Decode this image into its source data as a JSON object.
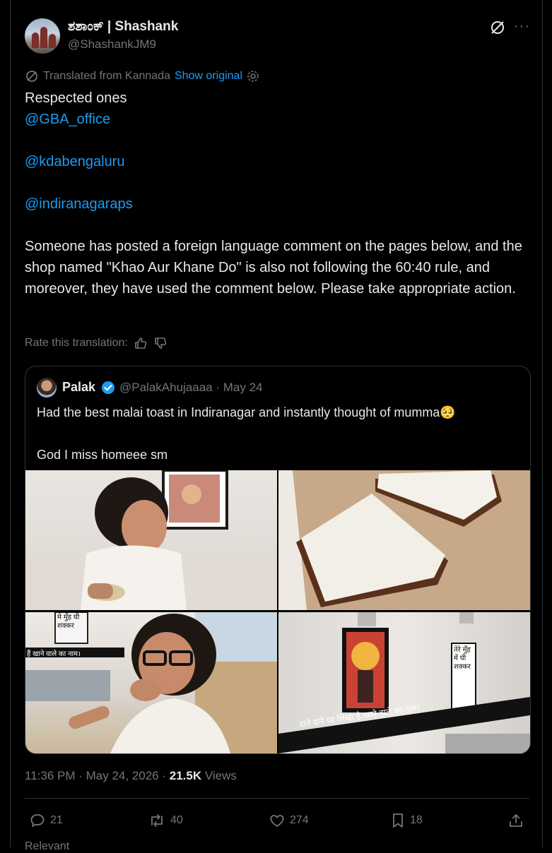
{
  "tweet": {
    "author_name": "ಶಶಾಂಕ್ | Shashank",
    "author_handle": "@ShashankJM9",
    "translated_label": "Translated from Kannada",
    "show_original": "Show original",
    "paragraphs": [
      {
        "text": "Respected ones",
        "type": "text"
      },
      {
        "text": "@GBA_office",
        "type": "mention"
      },
      {
        "text": "",
        "type": "blank"
      },
      {
        "text": "@kdabengaluru",
        "type": "mention"
      },
      {
        "text": "",
        "type": "blank"
      },
      {
        "text": "@indiranagaraps",
        "type": "mention"
      },
      {
        "text": "",
        "type": "blank"
      },
      {
        "text": "Someone has posted a foreign language comment on the pages below, and the shop named \"Khao Aur Khane Do\" is also not following the 60:40 rule, and moreover, they have used the comment below. Please take appropriate action.",
        "type": "text"
      }
    ],
    "rate_translation": "Rate this translation:",
    "timestamp": "11:36 PM · May 24, 2026 · ",
    "views_count": "21.5K",
    "views_label": " Views"
  },
  "quote": {
    "name": "Palak",
    "handle_date": "@PalakAhujaaaa · May 24",
    "line1": "Had the best malai toast in Indiranagar and instantly thought of mumma🥺",
    "line2": "God I miss homeee sm",
    "image_texts": {
      "poster_left": "मे मुँह घी शक्कर",
      "banner_left": "हैं खाने वाले का नाम।",
      "poster_right": "तेरे मुँह में घी शक्कर",
      "banner_right": "दाने दाने पर लिखा है खाने वाले का नाम।"
    }
  },
  "actions": {
    "replies": "21",
    "reposts": "40",
    "likes": "274",
    "bookmarks": "18"
  },
  "bottom_partial": "Relevant",
  "colors": {
    "background": "#000000",
    "text": "#e7e9ea",
    "secondary": "#71767b",
    "link": "#1d9bf0",
    "border": "#2f3336"
  }
}
